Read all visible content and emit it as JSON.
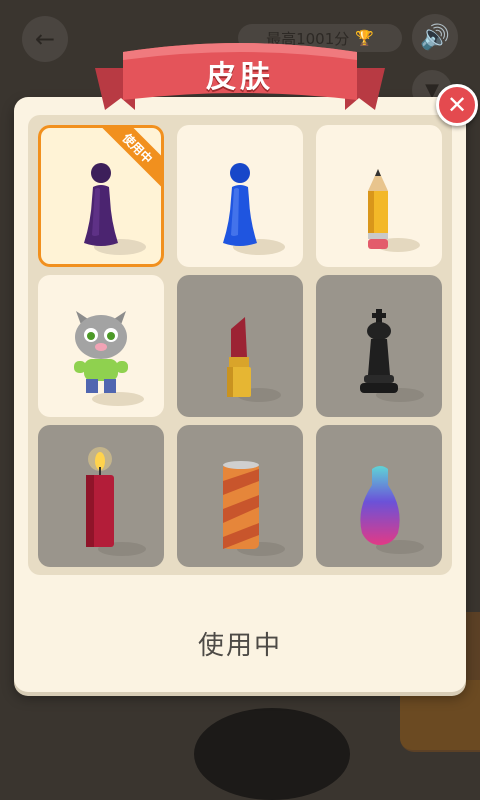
{
  "background": {
    "best_score_label": "最高1001分",
    "back_icon": "back-arrow-icon",
    "sound_icon": "speaker-icon",
    "trophy_icon": "trophy-icon",
    "shirt_icon": "tshirt-icon"
  },
  "dialog": {
    "title": "皮肤",
    "close_icon": "close-icon",
    "status_text": "使用中",
    "colors": {
      "accent": "#f1901e",
      "banner": "#e4545a",
      "close": "#e44a4f",
      "panel": "#fbf3e2"
    }
  },
  "skins": [
    {
      "id": "purple-pawn",
      "badge": "使用中",
      "selected": true,
      "locked": false
    },
    {
      "id": "blue-pawn",
      "selected": false,
      "locked": false
    },
    {
      "id": "pencil",
      "selected": false,
      "locked": false
    },
    {
      "id": "talking-tom",
      "selected": false,
      "locked": false
    },
    {
      "id": "lipstick",
      "selected": false,
      "locked": true
    },
    {
      "id": "chess-king",
      "selected": false,
      "locked": true
    },
    {
      "id": "candle",
      "selected": false,
      "locked": true
    },
    {
      "id": "soda-can",
      "selected": false,
      "locked": true
    },
    {
      "id": "gradient-bottle",
      "selected": false,
      "locked": true
    }
  ]
}
